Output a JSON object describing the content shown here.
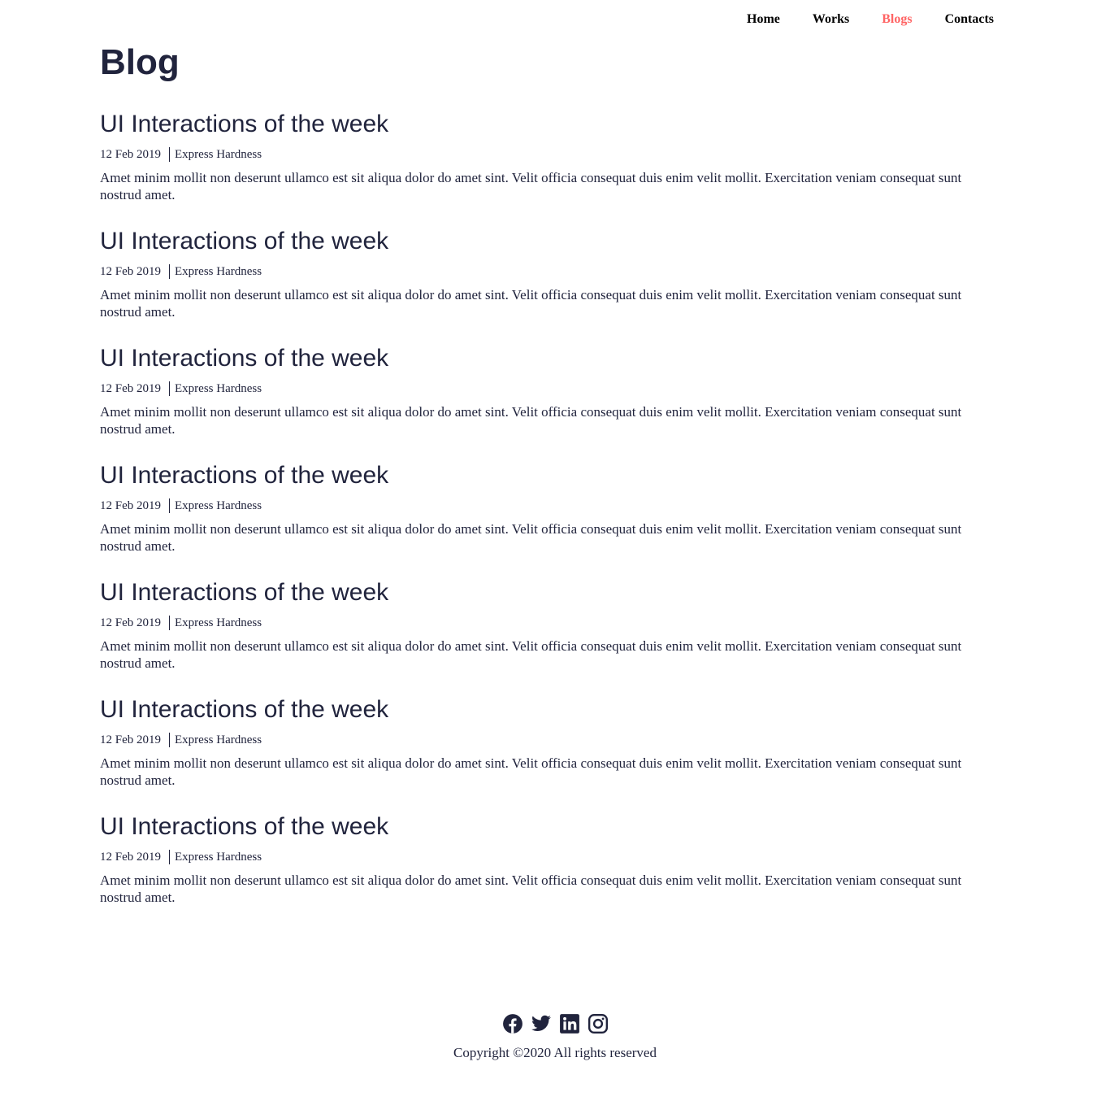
{
  "nav": {
    "items": [
      {
        "label": "Home",
        "active": false
      },
      {
        "label": "Works",
        "active": false
      },
      {
        "label": "Blogs",
        "active": true
      },
      {
        "label": "Contacts",
        "active": false
      }
    ]
  },
  "page": {
    "title": "Blog"
  },
  "posts": [
    {
      "title": "UI Interactions of the week",
      "date": "12 Feb 2019",
      "category": "Express Hardness",
      "excerpt": "Amet minim mollit non deserunt ullamco est sit aliqua dolor do amet sint. Velit officia consequat duis enim velit mollit. Exercitation veniam consequat sunt nostrud amet."
    },
    {
      "title": "UI Interactions of the week",
      "date": "12 Feb 2019",
      "category": "Express Hardness",
      "excerpt": "Amet minim mollit non deserunt ullamco est sit aliqua dolor do amet sint. Velit officia consequat duis enim velit mollit. Exercitation veniam consequat sunt nostrud amet."
    },
    {
      "title": "UI Interactions of the week",
      "date": "12 Feb 2019",
      "category": "Express Hardness",
      "excerpt": "Amet minim mollit non deserunt ullamco est sit aliqua dolor do amet sint. Velit officia consequat duis enim velit mollit. Exercitation veniam consequat sunt nostrud amet."
    },
    {
      "title": "UI Interactions of the week",
      "date": "12 Feb 2019",
      "category": "Express Hardness",
      "excerpt": "Amet minim mollit non deserunt ullamco est sit aliqua dolor do amet sint. Velit officia consequat duis enim velit mollit. Exercitation veniam consequat sunt nostrud amet."
    },
    {
      "title": "UI Interactions of the week",
      "date": "12 Feb 2019",
      "category": "Express Hardness",
      "excerpt": "Amet minim mollit non deserunt ullamco est sit aliqua dolor do amet sint. Velit officia consequat duis enim velit mollit. Exercitation veniam consequat sunt nostrud amet."
    },
    {
      "title": "UI Interactions of the week",
      "date": "12 Feb 2019",
      "category": "Express Hardness",
      "excerpt": "Amet minim mollit non deserunt ullamco est sit aliqua dolor do amet sint. Velit officia consequat duis enim velit mollit. Exercitation veniam consequat sunt nostrud amet."
    },
    {
      "title": "UI Interactions of the week",
      "date": "12 Feb 2019",
      "category": "Express Hardness",
      "excerpt": "Amet minim mollit non deserunt ullamco est sit aliqua dolor do amet sint. Velit officia consequat duis enim velit mollit. Exercitation veniam consequat sunt nostrud amet."
    }
  ],
  "footer": {
    "socials": [
      {
        "icon": "facebook-icon"
      },
      {
        "icon": "twitter-icon"
      },
      {
        "icon": "linkedin-icon"
      },
      {
        "icon": "instagram-icon"
      }
    ],
    "copyright": "Copyright ©2020 All rights reserved"
  },
  "colors": {
    "text": "#21243d",
    "accent": "#ff6464",
    "nav_text": "#000000",
    "background": "#ffffff"
  }
}
